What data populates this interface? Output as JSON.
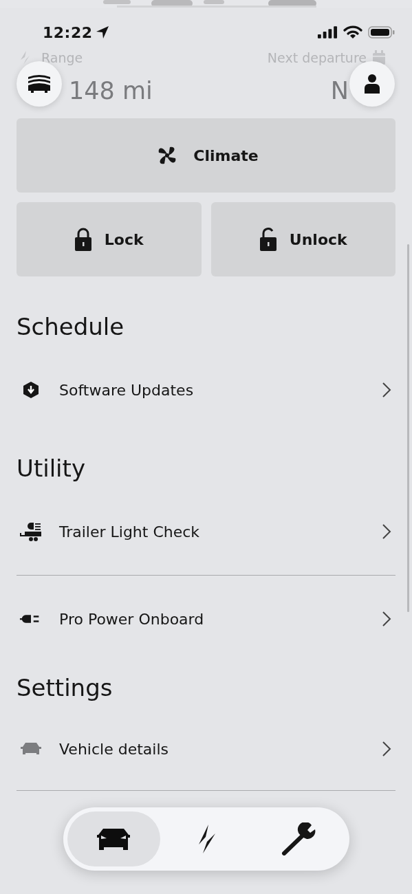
{
  "status_bar": {
    "time": "12:22"
  },
  "summary": {
    "range_label": "Range",
    "range_value": "148 mi",
    "departure_label": "Next departure",
    "departure_value": "N"
  },
  "actions": [
    {
      "label": "Climate",
      "kind": "fan"
    },
    {
      "label": "Lock",
      "kind": "locked"
    },
    {
      "label": "Unlock",
      "kind": "unlocked"
    }
  ],
  "sections": [
    {
      "title": "Schedule",
      "items": [
        {
          "label": "Software Updates",
          "kind": "update"
        }
      ]
    },
    {
      "title": "Utility",
      "items": [
        {
          "label": "Trailer Light Check",
          "kind": "trailer"
        },
        {
          "label": "Pro Power Onboard",
          "kind": "plug"
        }
      ]
    },
    {
      "title": "Settings",
      "items": [
        {
          "label": "Vehicle details",
          "kind": "car"
        }
      ]
    }
  ],
  "tab_bar": [
    {
      "kind": "vehicle",
      "selected": true
    },
    {
      "kind": "charge",
      "selected": false
    },
    {
      "kind": "service",
      "selected": false
    }
  ]
}
